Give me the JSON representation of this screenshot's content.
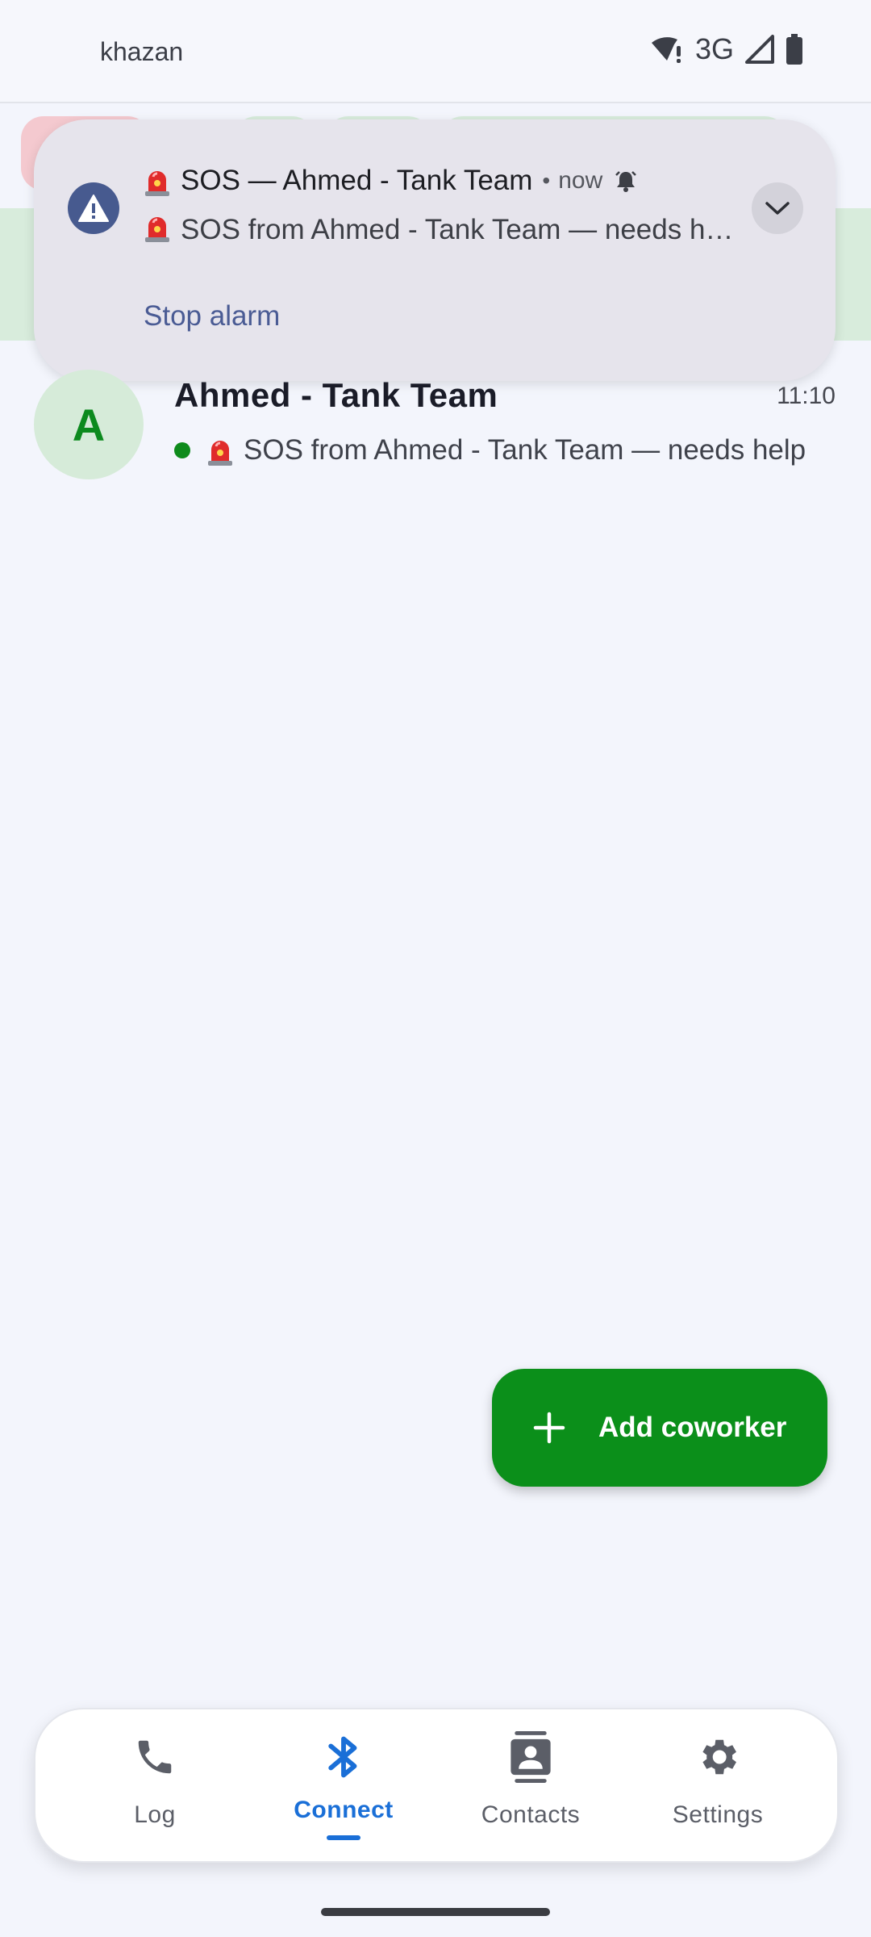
{
  "status_bar": {
    "carrier": "khazan",
    "network": "3G",
    "icons": [
      "wifi-alert-icon",
      "signal-icon",
      "battery-icon"
    ]
  },
  "notification": {
    "icon": "warning-triangle-icon",
    "title": "SOS — Ahmed - Tank Team",
    "time": "now",
    "body": "SOS from Ahmed - Tank Team — needs help",
    "action": "Stop alarm",
    "expand_icon": "chevron-down-icon"
  },
  "chat": {
    "avatar_letter": "A",
    "name": "Ahmed - Tank Team",
    "time": "11:10",
    "preview": "SOS from Ahmed - Tank Team — needs help"
  },
  "fab": {
    "label": "Add coworker",
    "icon": "plus-icon"
  },
  "bottom_nav": {
    "items": [
      {
        "label": "Log",
        "icon": "phone-icon",
        "active": false
      },
      {
        "label": "Connect",
        "icon": "bluetooth-icon",
        "active": true
      },
      {
        "label": "Contacts",
        "icon": "contact-card-icon",
        "active": false
      },
      {
        "label": "Settings",
        "icon": "gear-icon",
        "active": false
      }
    ]
  },
  "colors": {
    "accent_green": "#0b8f1a",
    "nav_active": "#1a6fd7",
    "notification_bg": "#e6e4ec"
  }
}
